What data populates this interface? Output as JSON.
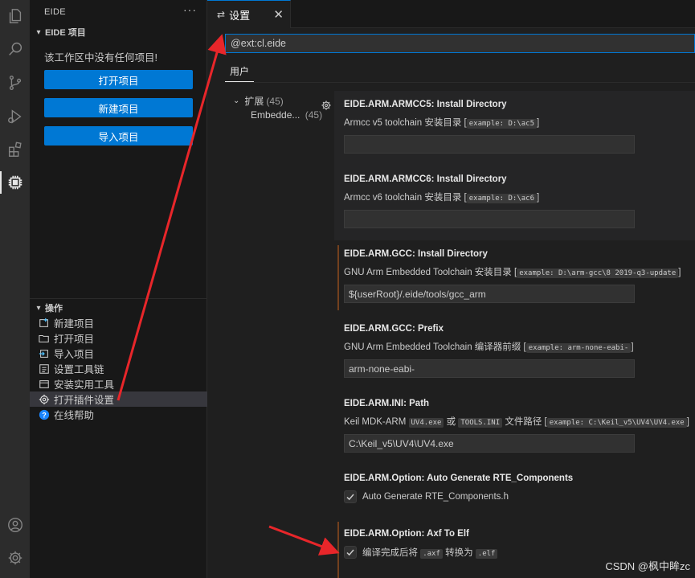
{
  "sidebar": {
    "title": "EIDE",
    "more": "···",
    "project_section": "EIDE 项目",
    "empty_message": "该工作区中没有任何项目!",
    "buttons": [
      "打开项目",
      "新建项目",
      "导入项目"
    ],
    "ops_section": "操作",
    "ops": [
      {
        "label": "新建项目",
        "icon": "new-project-icon"
      },
      {
        "label": "打开项目",
        "icon": "open-project-icon"
      },
      {
        "label": "导入项目",
        "icon": "import-project-icon"
      },
      {
        "label": "设置工具链",
        "icon": "toolchain-icon"
      },
      {
        "label": "安装实用工具",
        "icon": "install-tools-icon"
      },
      {
        "label": "打开插件设置",
        "icon": "gear-icon"
      },
      {
        "label": "在线帮助",
        "icon": "help-icon"
      }
    ]
  },
  "tab": {
    "label": "设置",
    "icon": "settings-tab-icon",
    "close": "✕"
  },
  "search": {
    "value": "@ext:cl.eide"
  },
  "scope": {
    "user_tab": "用户"
  },
  "toc": {
    "ext_label": "扩展",
    "ext_count": "(45)",
    "sub_label": "Embedde...",
    "sub_count": "(45)"
  },
  "settings": [
    {
      "category": "EIDE.ARM.ARMCC5: ",
      "name": "Install Directory",
      "desc": "Armcc v5 toolchain 安装目录",
      "example": "example: D:\\ac5",
      "value": ""
    },
    {
      "category": "EIDE.ARM.ARMCC6: ",
      "name": "Install Directory",
      "desc": "Armcc v6 toolchain 安装目录",
      "example": "example: D:\\ac6",
      "value": ""
    },
    {
      "category": "EIDE.ARM.GCC: ",
      "name": "Install Directory",
      "desc": "GNU Arm Embedded Toolchain 安装目录",
      "example": "example: D:\\arm-gcc\\8 2019-q3-update",
      "value": "${userRoot}/.eide/tools/gcc_arm"
    },
    {
      "category": "EIDE.ARM.GCC: ",
      "name": "Prefix",
      "desc": "GNU Arm Embedded Toolchain 编译器前缀",
      "example": "example: arm-none-eabi-",
      "value": "arm-none-eabi-"
    },
    {
      "category": "EIDE.ARM.INI: ",
      "name": "Path",
      "desc_pre": "Keil MDK-ARM",
      "code1": "UV4.exe",
      "or": "或",
      "code2": "TOOLS.INI",
      "desc_post": "文件路径",
      "example": "example: C:\\Keil_v5\\UV4\\UV4.exe",
      "value": "C:\\Keil_v5\\UV4\\UV4.exe"
    },
    {
      "category": "EIDE.ARM.Option: ",
      "name": "Auto Generate RTE_Components",
      "check_label": "Auto Generate RTE_Components.h",
      "checked": true
    },
    {
      "category": "EIDE.ARM.Option: ",
      "name": "Axf To Elf",
      "check_pre": "编译完成后将",
      "code1": ".axf",
      "mid": "转换为",
      "code2": ".elf",
      "checked": true
    }
  ],
  "watermark": "CSDN @枫中眸zc",
  "colors": {
    "accent": "#0078d4",
    "arrow": "#e8262a",
    "modified": "#73401e"
  }
}
